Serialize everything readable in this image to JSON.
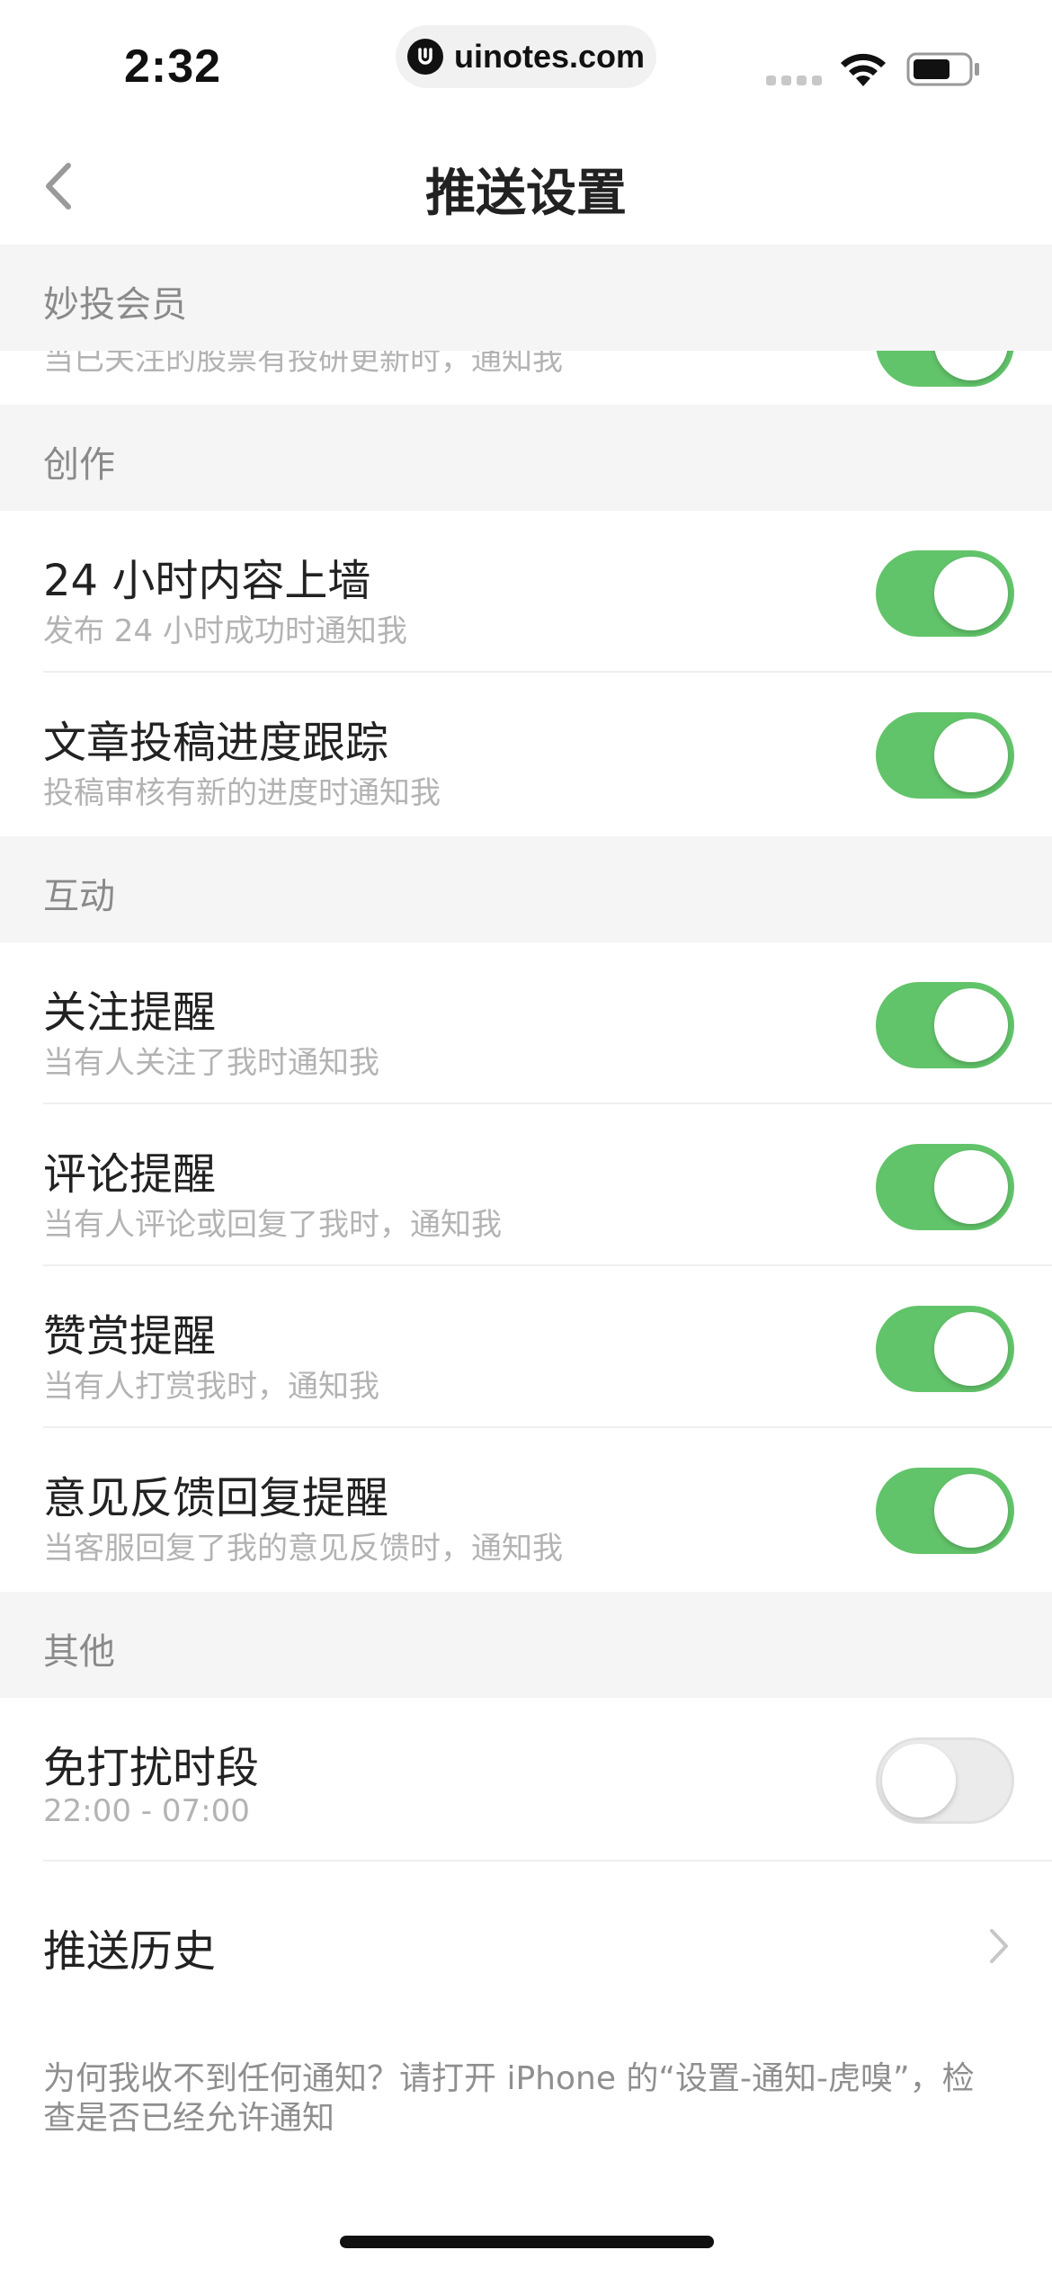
{
  "status_bar": {
    "time": "2:32",
    "url": "uinotes.com"
  },
  "nav": {
    "title": "推送设置"
  },
  "sections": [
    {
      "label": "妙投会员",
      "partial_row_subtitle": "当已关注的股票有投研更新时，通知我",
      "partial_row_toggle": true
    },
    {
      "label": "创作",
      "items": [
        {
          "title": "24 小时内容上墙",
          "subtitle": "发布 24 小时成功时通知我",
          "enabled": true
        },
        {
          "title": "文章投稿进度跟踪",
          "subtitle": "投稿审核有新的进度时通知我",
          "enabled": true
        }
      ]
    },
    {
      "label": "互动",
      "items": [
        {
          "title": "关注提醒",
          "subtitle": "当有人关注了我时通知我",
          "enabled": true
        },
        {
          "title": "评论提醒",
          "subtitle": "当有人评论或回复了我时，通知我",
          "enabled": true
        },
        {
          "title": "赞赏提醒",
          "subtitle": "当有人打赏我时，通知我",
          "enabled": true
        },
        {
          "title": "意见反馈回复提醒",
          "subtitle": "当客服回复了我的意见反馈时，通知我",
          "enabled": true
        }
      ]
    },
    {
      "label": "其他",
      "items": [
        {
          "title": "免打扰时段",
          "subtitle": "22:00 - 07:00",
          "enabled": false
        },
        {
          "title": "推送历史"
        }
      ]
    }
  ],
  "footer_note": "为何我收不到任何通知？请打开 iPhone 的“设置-通知-虎嗅”，检查是否已经允许通知",
  "colors": {
    "toggle_on": "#62c46a",
    "section_bg": "#f5f5f5",
    "subtitle": "#b3b3b3"
  }
}
